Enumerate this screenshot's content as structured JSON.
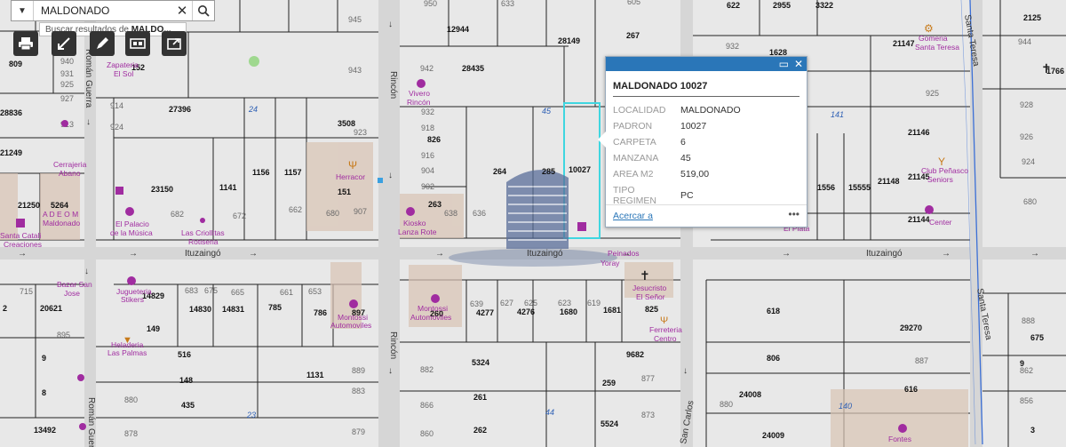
{
  "search": {
    "value": "MALDONADO",
    "suggestion_prefix": "Buscar resultados de ",
    "suggestion_term": "MALDO..."
  },
  "popup": {
    "title": "MALDONADO 10027",
    "fields": [
      {
        "key": "LOCALIDAD",
        "value": "MALDONADO"
      },
      {
        "key": "PADRON",
        "value": "10027"
      },
      {
        "key": "CARPETA",
        "value": "6"
      },
      {
        "key": "MANZANA",
        "value": "45"
      },
      {
        "key": "AREA M2",
        "value": "519,00"
      },
      {
        "key": "TIPO REGIMEN",
        "value": "PC"
      }
    ],
    "zoom_link": "Acercar a",
    "more": "•••"
  },
  "streets": {
    "ituzaingo": "Ituzaingó",
    "rincon": "Rincón",
    "roman_guerra": "Román Guerra",
    "santa_teresa": "Santa Teresa",
    "san_carlos": "San Carlos"
  },
  "colors": {
    "selected_parcel": "#3fd6e0",
    "poi": "#a02ca0",
    "manzana_label": "#2d5fb4",
    "popup_header": "#2a76b8"
  }
}
